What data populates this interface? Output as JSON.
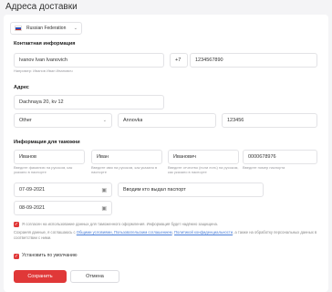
{
  "page_title": "Адреса доставки",
  "country_select": {
    "value": "Russian Federation"
  },
  "contact": {
    "title": "Контактная информация",
    "name_value": "Ivanov Ivan Ivanovich",
    "name_hint": "Например: Иванов Иван Иванович",
    "phone_code": "+7",
    "phone_value": "1234567890"
  },
  "address": {
    "title": "Адрес",
    "street_value": "Dachnaya 20, kv 12",
    "region_value": "Other",
    "city_value": "Annovka",
    "zip_value": "123456"
  },
  "customs": {
    "title": "Информация для таможни",
    "last_name": "Иванов",
    "first_name": "Иван",
    "middle_name": "Иванович",
    "passport_no": "0000678976",
    "last_name_hint": "Введите фамилию на русском, как указано в паспорте",
    "first_name_hint": "Введите имя на русском, как указано в паспорте",
    "middle_name_hint": "Введите отчество (если есть) на русском, как указано в паспорте",
    "passport_hint": "Введите номер паспорта",
    "issue_date": "07-09-2021",
    "issued_by": "Вводим кто выдал паспорт",
    "birth_date": "08-09-2021"
  },
  "consent": {
    "customs_text": "Я согласен на использование данных для таможенного оформления. Информация будет надёжно защищена.",
    "terms_prefix": "Сохраняя данные, я соглашаюсь с",
    "terms_link1": "Общими условиями, Пользовательским соглашением",
    "terms_mid": ",",
    "terms_link2": "Политикой конфиденциальности",
    "terms_suffix": ", а также на обработку персональных данных в соответствии с ними.",
    "default_label": "Установить по умолчанию"
  },
  "buttons": {
    "save": "Сохранить",
    "cancel": "Отмена"
  },
  "colors": {
    "accent": "#e03838",
    "link": "#4a7ed8"
  }
}
